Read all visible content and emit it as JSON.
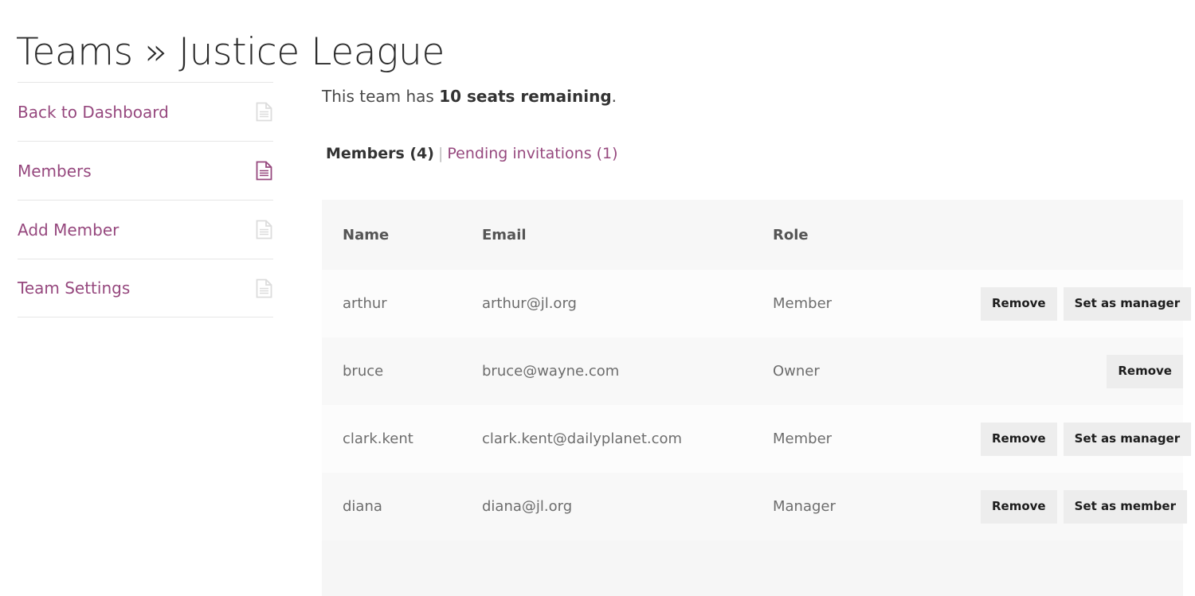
{
  "page": {
    "title": "Teams » Justice League"
  },
  "sidebar": {
    "items": [
      {
        "label": "Back to Dashboard",
        "icon": "document-icon",
        "active": false
      },
      {
        "label": "Members",
        "icon": "document-icon",
        "active": true
      },
      {
        "label": "Add Member",
        "icon": "document-icon",
        "active": false
      },
      {
        "label": "Team Settings",
        "icon": "document-icon",
        "active": false
      }
    ]
  },
  "main": {
    "seats_notice": {
      "prefix": "This team has ",
      "highlight": "10 seats remaining",
      "suffix": "."
    },
    "tabs": {
      "active_label": "Members (4)",
      "separator": "|",
      "link_label": "Pending invitations (1)"
    },
    "table": {
      "columns": [
        "Name",
        "Email",
        "Role",
        ""
      ],
      "rows": [
        {
          "name": "arthur",
          "email": "arthur@jl.org",
          "role": "Member",
          "actions": [
            "Remove",
            "Set as manager"
          ]
        },
        {
          "name": "bruce",
          "email": "bruce@wayne.com",
          "role": "Owner",
          "actions": [
            "Remove"
          ]
        },
        {
          "name": "clark.kent",
          "email": "clark.kent@dailyplanet.com",
          "role": "Member",
          "actions": [
            "Remove",
            "Set as manager"
          ]
        },
        {
          "name": "diana",
          "email": "diana@jl.org",
          "role": "Manager",
          "actions": [
            "Remove",
            "Set as member"
          ]
        }
      ]
    }
  },
  "colors": {
    "accent_purple": "#96487e",
    "title_text": "#2c2c2c",
    "body_text": "#6d6d6d",
    "row_odd": "#fcfcfc",
    "row_even": "#f8f8f8",
    "header_bg": "#f7f7f7",
    "button_bg": "#ededed"
  }
}
